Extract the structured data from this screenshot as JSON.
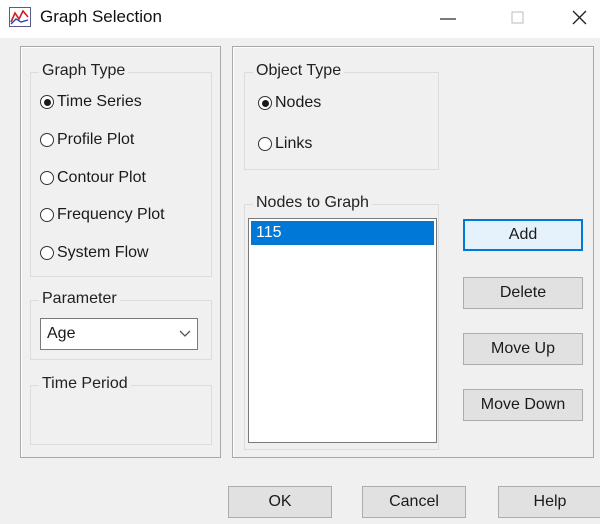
{
  "window": {
    "title": "Graph Selection",
    "controls": {
      "minimize": "minimize-icon",
      "maximize": "maximize-icon",
      "close": "close-icon"
    }
  },
  "graph_type": {
    "label": "Graph Type",
    "options": [
      "Time Series",
      "Profile Plot",
      "Contour Plot",
      "Frequency Plot",
      "System Flow"
    ],
    "selected": "Time Series"
  },
  "parameter": {
    "label": "Parameter",
    "value": "Age"
  },
  "time_period": {
    "label": "Time Period"
  },
  "object_type": {
    "label": "Object Type",
    "options": [
      "Nodes",
      "Links"
    ],
    "selected": "Nodes"
  },
  "nodes_to_graph": {
    "label": "Nodes to Graph",
    "items": [
      "115"
    ],
    "selected": "115"
  },
  "side_buttons": {
    "add": "Add",
    "delete": "Delete",
    "move_up": "Move Up",
    "move_down": "Move Down"
  },
  "footer_buttons": {
    "ok": "OK",
    "cancel": "Cancel",
    "help": "Help"
  },
  "colors": {
    "selection": "#0078d7",
    "dialog_bg": "#f0f0f0",
    "default_button_border": "#0078d7"
  }
}
